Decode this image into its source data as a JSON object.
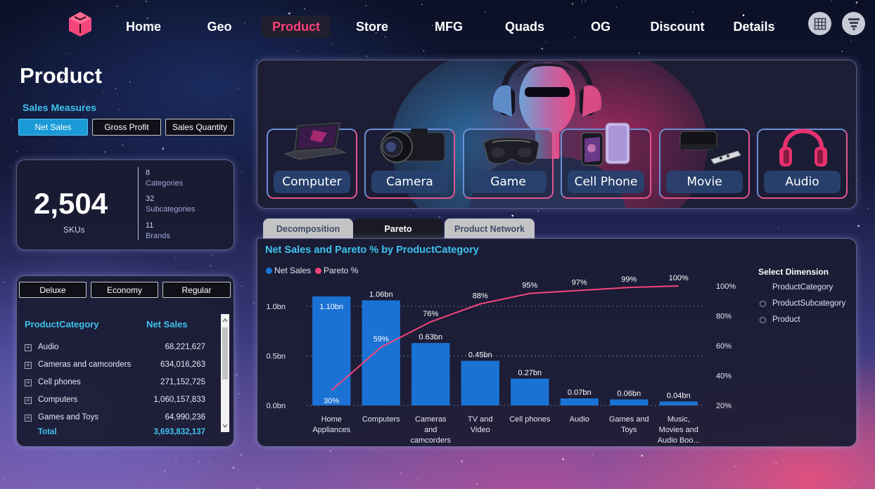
{
  "nav": {
    "items": [
      "Home",
      "Geo",
      "Product",
      "Store",
      "MFG",
      "Quads",
      "OG",
      "Discount",
      "Details"
    ],
    "active": "Product",
    "accent": "#ff3e7a"
  },
  "page": {
    "title": "Product"
  },
  "measures": {
    "title": "Sales Measures",
    "buttons": [
      "Net Sales",
      "Gross Profit",
      "Sales Quantity"
    ],
    "active": "Net Sales"
  },
  "kpi": {
    "skus_value": "2,504",
    "skus_label": "SKUs",
    "categories_value": "8",
    "categories_label": "Categories",
    "subcategories_value": "32",
    "subcategories_label": "Subcategories",
    "brands_value": "11",
    "brands_label": "Brands"
  },
  "segment_buttons": [
    "Deluxe",
    "Economy",
    "Regular"
  ],
  "category_table": {
    "headers": [
      "ProductCategory",
      "Net Sales"
    ],
    "rows": [
      {
        "label": "Audio",
        "value": "68,221,627"
      },
      {
        "label": "Cameras and camcorders",
        "value": "634,016,263"
      },
      {
        "label": "Cell phones",
        "value": "271,152,725"
      },
      {
        "label": "Computers",
        "value": "1,060,157,833"
      },
      {
        "label": "Games and Toys",
        "value": "64,990,236"
      }
    ],
    "total_label": "Total",
    "total_value": "3,693,832,137"
  },
  "product_tiles": [
    "Computer",
    "Camera",
    "Game",
    "Cell Phone",
    "Movie",
    "Audio"
  ],
  "tabs": [
    "Decomposition",
    "Pareto",
    "Product Network"
  ],
  "active_tab": "Pareto",
  "select_dimension": {
    "title": "Select Dimension",
    "options": [
      "ProductCategory",
      "ProductSubcategory",
      "Product"
    ],
    "selected": "ProductCategory"
  },
  "chart_data": {
    "type": "bar",
    "title": "Net Sales and Pareto % by ProductCategory",
    "categories": [
      "Home Appliances",
      "Computers",
      "Cameras and camcorders",
      "TV and Video",
      "Cell phones",
      "Audio",
      "Games and Toys",
      "Music, Movies and Audio Boo..."
    ],
    "category_label_lines": [
      [
        "Home",
        "Appliances"
      ],
      [
        "Computers"
      ],
      [
        "Cameras",
        "and",
        "camcorders"
      ],
      [
        "TV and",
        "Video"
      ],
      [
        "Cell phones"
      ],
      [
        "Audio"
      ],
      [
        "Games and",
        "Toys"
      ],
      [
        "Music,",
        "Movies and",
        "Audio Boo..."
      ]
    ],
    "series": [
      {
        "name": "Net Sales",
        "color": "#1a73d4",
        "values": [
          1.1,
          1.06,
          0.63,
          0.45,
          0.27,
          0.07,
          0.06,
          0.04
        ],
        "labels": [
          "1.10bn",
          "1.06bn",
          "0.63bn",
          "0.45bn",
          "0.27bn",
          "0.07bn",
          "0.06bn",
          "0.04bn"
        ]
      },
      {
        "name": "Pareto %",
        "color": "#f2467a",
        "values": [
          30,
          59,
          76,
          88,
          95,
          97,
          99,
          100
        ],
        "labels": [
          "30%",
          "59%",
          "76%",
          "88%",
          "95%",
          "97%",
          "99%",
          "100%"
        ]
      }
    ],
    "y_left": {
      "ticks": [
        "0.0bn",
        "0.5bn",
        "1.0bn"
      ],
      "tick_values": [
        0,
        0.5,
        1.0
      ],
      "range": [
        0,
        1.1
      ]
    },
    "y_right": {
      "ticks": [
        "20%",
        "40%",
        "60%",
        "80%",
        "100%"
      ],
      "tick_values": [
        20,
        40,
        60,
        80,
        100
      ],
      "range": [
        20,
        100
      ]
    },
    "legend_position": "top-left",
    "grid": "dotted"
  }
}
